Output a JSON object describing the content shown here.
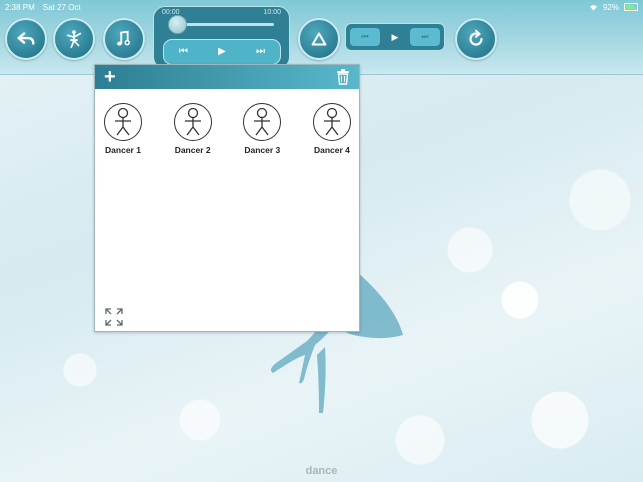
{
  "status": {
    "time": "2:38 PM",
    "date": "Sat 27 Oct",
    "battery": "92%"
  },
  "toolbar": {
    "buttons": [
      {
        "name": "back-button",
        "icon": "back-arrow-icon"
      },
      {
        "name": "dance-mode-button",
        "icon": "ballerina-icon"
      },
      {
        "name": "music-button",
        "icon": "music-note-icon"
      },
      {
        "name": "formation-button",
        "icon": "triangle-icon"
      },
      {
        "name": "reset-button",
        "icon": "refresh-icon"
      }
    ],
    "player": {
      "time_start": "00:00",
      "time_end": "10:00",
      "progress": 0
    },
    "colors": {
      "accent": "#2f8094",
      "toolbar_bg": "#a6d8e2"
    }
  },
  "panel": {
    "dancers": [
      {
        "label": "Dancer 1"
      },
      {
        "label": "Dancer 2"
      },
      {
        "label": "Dancer 3"
      },
      {
        "label": "Dancer 4"
      }
    ]
  },
  "footer": {
    "label": "dance"
  }
}
